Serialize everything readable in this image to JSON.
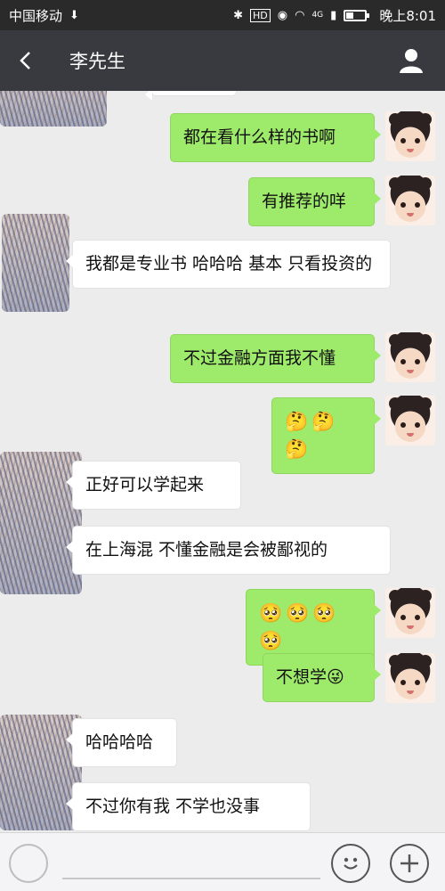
{
  "status_bar": {
    "carrier": "中国移动",
    "network": "4G",
    "time": "晚上8:01",
    "hd_label": "HD"
  },
  "header": {
    "title": "李先生",
    "back_icon": "back-arrow-icon",
    "profile_icon": "person-icon"
  },
  "messages": [
    {
      "side": "right",
      "text": "都在看什么样的书啊"
    },
    {
      "side": "right",
      "text": "有推荐的咩"
    },
    {
      "side": "left",
      "text": "我都是专业书 哈哈哈  基本 只看投资的"
    },
    {
      "side": "right",
      "text": "不过金融方面我不懂"
    },
    {
      "side": "right",
      "text": "🤔🤔🤔"
    },
    {
      "side": "left",
      "text": "正好可以学起来"
    },
    {
      "side": "left",
      "text": "在上海混  不懂金融是会被鄙视的"
    },
    {
      "side": "right",
      "text": "🥺🥺🥺🥺"
    },
    {
      "side": "right",
      "text": "不想学😜"
    },
    {
      "side": "left",
      "text": "哈哈哈哈"
    },
    {
      "side": "left",
      "text": "不过你有我  不学也没事"
    }
  ],
  "bottom_bar": {
    "emoji_icon": "smiley-icon",
    "plus_icon": "plus-icon"
  }
}
